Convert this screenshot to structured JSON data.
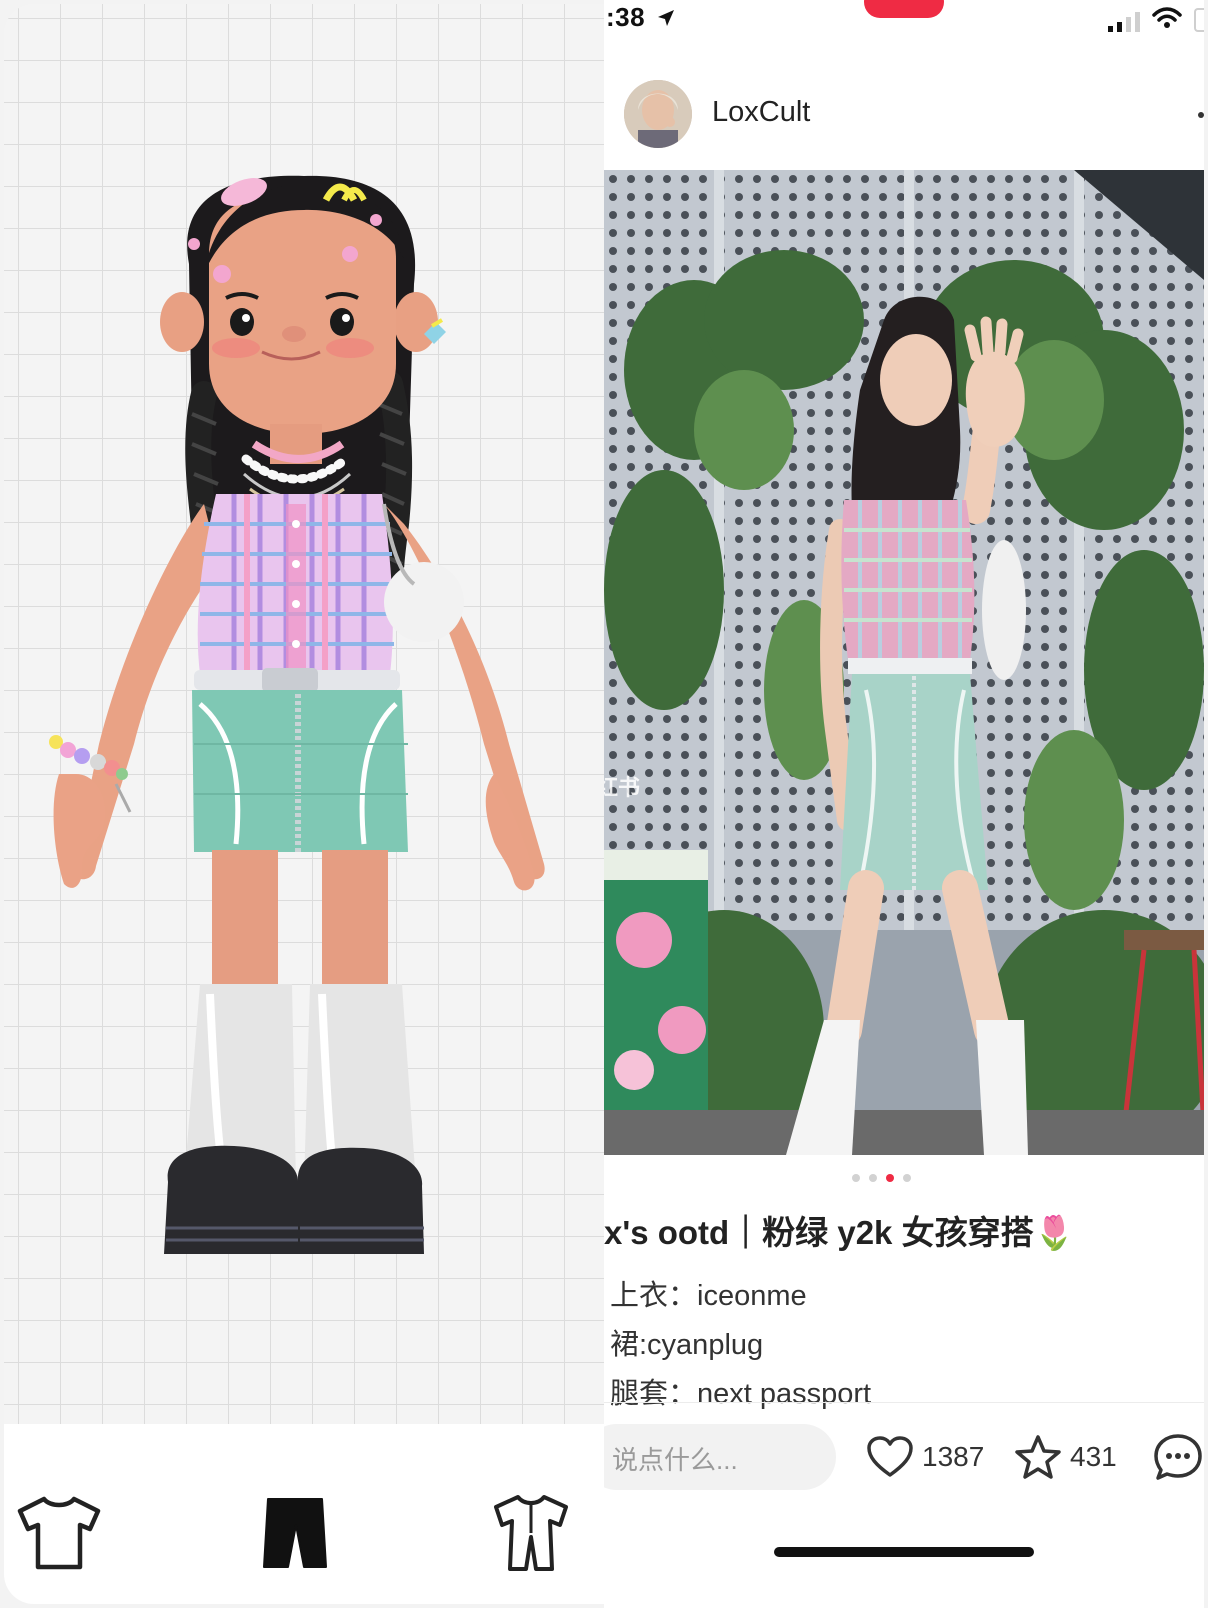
{
  "left_panel": {
    "tools": [
      {
        "icon": "t-shirt-icon",
        "active": false
      },
      {
        "icon": "pants-icon",
        "active": true
      },
      {
        "icon": "jumpsuit-icon",
        "active": false
      }
    ]
  },
  "status_bar": {
    "time": ":38",
    "record_indicator_color": "#ef2b44"
  },
  "post": {
    "username": "LoxCult",
    "photo_watermark": "小红书",
    "carousel": {
      "count": 4,
      "active_index": 2
    },
    "title": "x's ootd｜粉绿 y2k 女孩穿搭🌷",
    "lines": [
      "上衣：iceonme",
      "裙:cyanplug",
      "腿套：next passport"
    ],
    "comment_placeholder": "说点什么...",
    "likes": "1387",
    "favorites": "431"
  },
  "colors": {
    "accent": "#ef2b44",
    "grid_line": "#dcdcdc",
    "skirt_green": "#7fc8b4",
    "top_pink": "#e7a3c8"
  }
}
